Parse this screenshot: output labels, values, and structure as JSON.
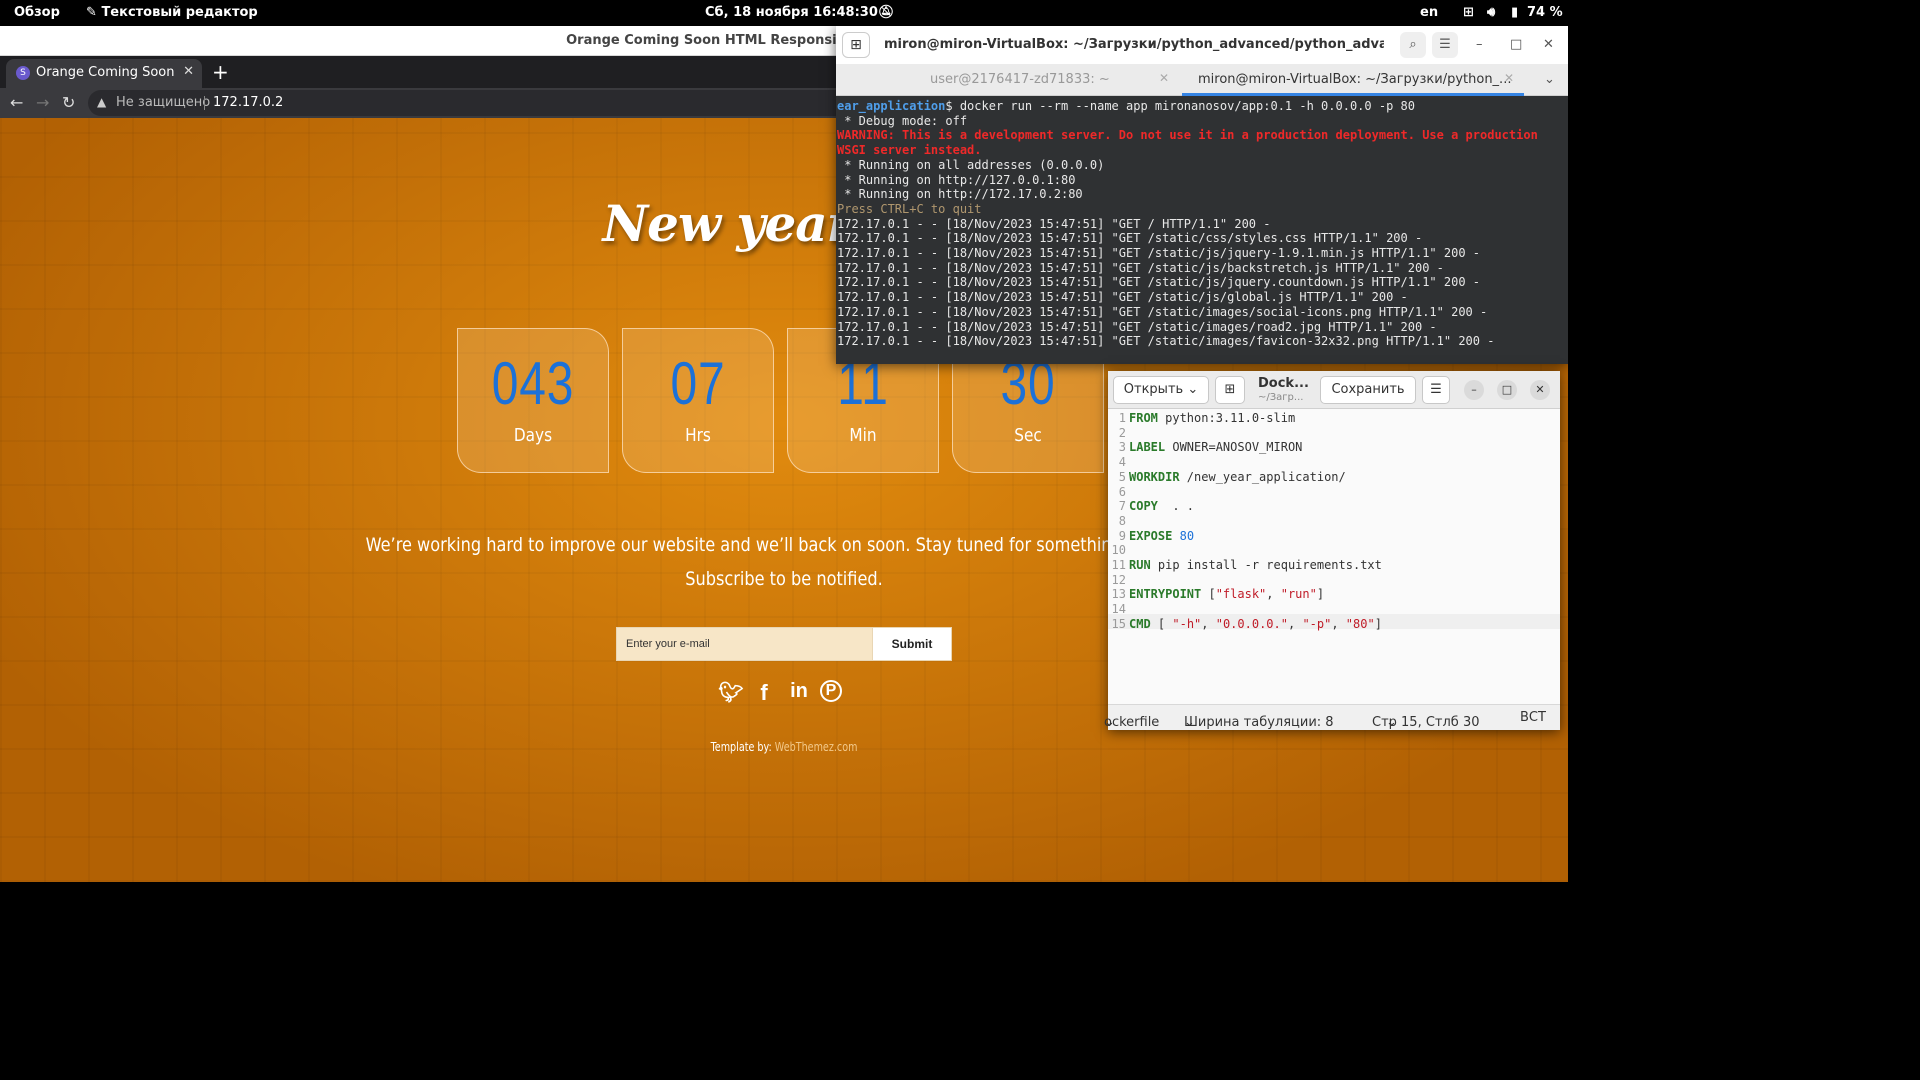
{
  "topbar": {
    "activities": "Обзор",
    "app_name": "Текстовый редактор",
    "clock": "Сб, 18 ноября 16:48:30",
    "lang": "en",
    "battery": "74 %"
  },
  "browser": {
    "window_title": "Orange Coming Soon HTML Responsive",
    "tab_title": "Orange Coming Soon",
    "security_label": "Не защищено",
    "url": "172.17.0.2"
  },
  "page": {
    "headline": "New year cou",
    "countdown": [
      {
        "value": "043",
        "unit": "Days"
      },
      {
        "value": "07",
        "unit": "Hrs"
      },
      {
        "value": "11",
        "unit": "Min"
      },
      {
        "value": "30",
        "unit": "Sec"
      }
    ],
    "tagline_1": "We’re working hard to improve our website and we’ll back on soon. Stay tuned for something amazing!",
    "tagline_2": "Subscribe to be notified.",
    "email_placeholder": "Enter your e-mail",
    "submit_label": "Submit",
    "social": [
      "twitter",
      "facebook",
      "linkedin",
      "pinterest"
    ],
    "credit_prefix": "Template by:",
    "credit_link": "WebThemez.com"
  },
  "terminal": {
    "title": "miron@miron-VirtualBox: ~/Загрузки/python_advanced/python_advance...",
    "tab_1": "user@2176417-zd71833: ~",
    "tab_2": "miron@miron-VirtualBox: ~/Загрузки/python_...",
    "prompt_dir": "ear_application",
    "command": "$ docker run --rm --name app mironanosov/app:0.1 -h 0.0.0.0 -p 80",
    "debug": " * Debug mode: off",
    "warning_1": "WARNING: This is a development server. Do not use it in a production deployment. Use a production",
    "warning_2": "WSGI server instead.",
    "running": [
      " * Running on all addresses (0.0.0.0)",
      " * Running on http://127.0.0.1:80",
      " * Running on http://172.17.0.2:80"
    ],
    "quit_hint": "Press CTRL+C to quit",
    "log": [
      "172.17.0.1 - - [18/Nov/2023 15:47:51] \"GET / HTTP/1.1\" 200 -",
      "172.17.0.1 - - [18/Nov/2023 15:47:51] \"GET /static/css/styles.css HTTP/1.1\" 200 -",
      "172.17.0.1 - - [18/Nov/2023 15:47:51] \"GET /static/js/jquery-1.9.1.min.js HTTP/1.1\" 200 -",
      "172.17.0.1 - - [18/Nov/2023 15:47:51] \"GET /static/js/backstretch.js HTTP/1.1\" 200 -",
      "172.17.0.1 - - [18/Nov/2023 15:47:51] \"GET /static/js/jquery.countdown.js HTTP/1.1\" 200 -",
      "172.17.0.1 - - [18/Nov/2023 15:47:51] \"GET /static/js/global.js HTTP/1.1\" 200 -",
      "172.17.0.1 - - [18/Nov/2023 15:47:51] \"GET /static/images/social-icons.png HTTP/1.1\" 200 -",
      "172.17.0.1 - - [18/Nov/2023 15:47:51] \"GET /static/images/road2.jpg HTTP/1.1\" 200 -",
      "172.17.0.1 - - [18/Nov/2023 15:47:51] \"GET /static/images/favicon-32x32.png HTTP/1.1\" 200 -"
    ]
  },
  "editor": {
    "open_label": "Открыть",
    "file_name": "Dock...",
    "file_path": "~/Загр...",
    "save_label": "Сохранить",
    "lines": [
      {
        "n": "1",
        "html": "<span class='kw'>FROM</span> python:3.11.0-slim"
      },
      {
        "n": "2",
        "html": ""
      },
      {
        "n": "3",
        "html": "<span class='kw'>LABEL</span> OWNER=ANOSOV_MIRON"
      },
      {
        "n": "4",
        "html": ""
      },
      {
        "n": "5",
        "html": "<span class='kw'>WORKDIR</span> /new_year_application/"
      },
      {
        "n": "6",
        "html": ""
      },
      {
        "n": "7",
        "html": "<span class='kw'>COPY</span>  . ."
      },
      {
        "n": "8",
        "html": ""
      },
      {
        "n": "9",
        "html": "<span class='kw'>EXPOSE</span> <span class='num'>80</span>"
      },
      {
        "n": "10",
        "html": ""
      },
      {
        "n": "11",
        "html": "<span class='kw'>RUN</span> pip install -r requirements.txt"
      },
      {
        "n": "12",
        "html": ""
      },
      {
        "n": "13",
        "html": "<span class='kw'>ENTRYPOINT</span> [<span class='str'>\"flask\"</span>, <span class='str'>\"run\"</span>]"
      },
      {
        "n": "14",
        "html": ""
      },
      {
        "n": "15",
        "html": "<span class='kw'>CMD</span> [ <span class='str'>\"-h\"</span>, <span class='str'>\"0.0.0.0.\"</span>, <span class='str'>\"-p\"</span>, <span class='str'>\"80\"</span>]"
      }
    ],
    "status_lang": "ockerfile",
    "status_tab": "Ширина табуляции: 8",
    "status_pos": "Стр 15, Стлб 30",
    "status_mode": "ВСТ"
  }
}
